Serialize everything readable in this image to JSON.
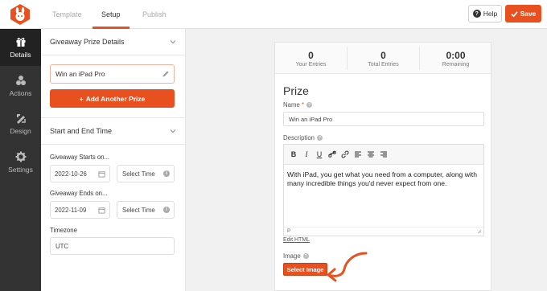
{
  "header": {
    "tabs": [
      {
        "label": "Template"
      },
      {
        "label": "Setup"
      },
      {
        "label": "Publish"
      }
    ],
    "help_label": "Help",
    "save_label": "Save",
    "accent_color": "#e8501f"
  },
  "sidebar": {
    "items": [
      {
        "label": "Details",
        "icon": "gift-icon"
      },
      {
        "label": "Actions",
        "icon": "actions-icon"
      },
      {
        "label": "Design",
        "icon": "design-icon"
      },
      {
        "label": "Settings",
        "icon": "gear-icon"
      }
    ]
  },
  "left_panel": {
    "prize_section_title": "Giveaway Prize Details",
    "prize_value": "Win an iPad Pro",
    "add_prize_label": "Add Another Prize",
    "time_section_title": "Start and End Time",
    "starts_label": "Giveaway Starts on...",
    "start_date": "2022-10-26",
    "start_time_placeholder": "Select Time",
    "ends_label": "Giveaway Ends on...",
    "end_date": "2022-11-09",
    "end_time_placeholder": "Select Time",
    "timezone_label": "Timezone",
    "timezone_value": "UTC"
  },
  "preview": {
    "stats": [
      {
        "value": "0",
        "label": "Your Entries"
      },
      {
        "value": "0",
        "label": "Total Entries"
      },
      {
        "value": "0:00",
        "label": "Remaining"
      }
    ],
    "prize_heading": "Prize",
    "name_label": "Name",
    "name_required_mark": "*",
    "name_value": "Win an iPad Pro",
    "description_label": "Description",
    "description_text": "With iPad, you get what you need from a computer, along with many incredible things you'd never expect from one.",
    "editor_status": "P",
    "edit_html_label": "Edit HTML",
    "image_label": "Image",
    "select_image_label": "Select Image"
  }
}
